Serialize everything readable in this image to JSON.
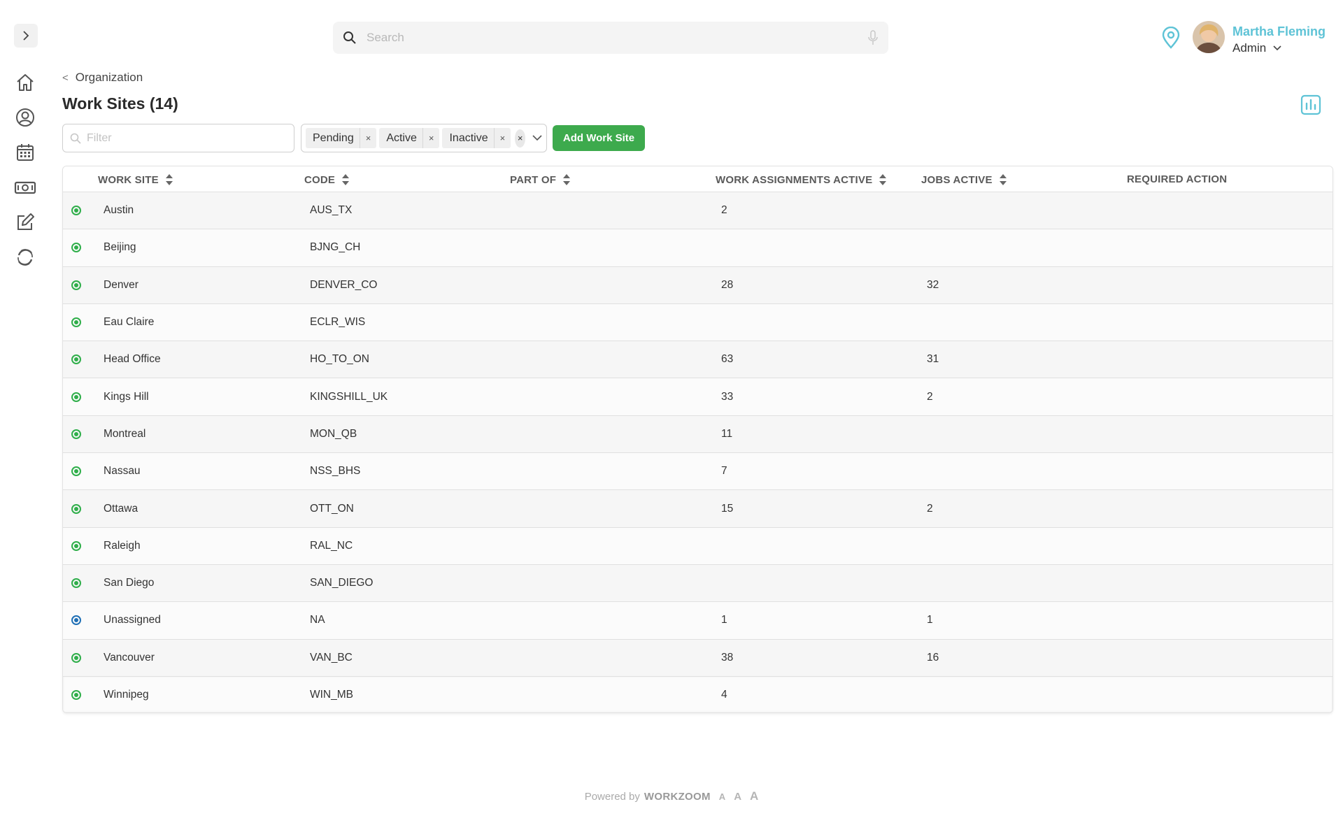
{
  "search": {
    "placeholder": "Search"
  },
  "user": {
    "name": "Martha Fleming",
    "role": "Admin"
  },
  "breadcrumb": {
    "label": "Organization"
  },
  "page": {
    "title": "Work Sites (14)"
  },
  "filter": {
    "placeholder": "Filter"
  },
  "status_chips": [
    {
      "label": "Pending"
    },
    {
      "label": "Active"
    },
    {
      "label": "Inactive"
    }
  ],
  "add_button": {
    "label": "Add Work Site"
  },
  "columns": {
    "work_site": "WORK SITE",
    "code": "CODE",
    "part_of": "PART OF",
    "work_assignments_active": "WORK ASSIGNMENTS ACTIVE",
    "jobs_active": "JOBS ACTIVE",
    "required_action": "REQUIRED ACTION"
  },
  "rows": [
    {
      "status": "active",
      "name": "Austin",
      "code": "AUS_TX",
      "part_of": "",
      "wa": "2",
      "jobs": "",
      "action": ""
    },
    {
      "status": "active",
      "name": "Beijing",
      "code": "BJNG_CH",
      "part_of": "",
      "wa": "",
      "jobs": "",
      "action": ""
    },
    {
      "status": "active",
      "name": "Denver",
      "code": "DENVER_CO",
      "part_of": "",
      "wa": "28",
      "jobs": "32",
      "action": ""
    },
    {
      "status": "active",
      "name": "Eau Claire",
      "code": "ECLR_WIS",
      "part_of": "",
      "wa": "",
      "jobs": "",
      "action": ""
    },
    {
      "status": "active",
      "name": "Head Office",
      "code": "HO_TO_ON",
      "part_of": "",
      "wa": "63",
      "jobs": "31",
      "action": ""
    },
    {
      "status": "active",
      "name": "Kings Hill",
      "code": "KINGSHILL_UK",
      "part_of": "",
      "wa": "33",
      "jobs": "2",
      "action": ""
    },
    {
      "status": "active",
      "name": "Montreal",
      "code": "MON_QB",
      "part_of": "",
      "wa": "11",
      "jobs": "",
      "action": ""
    },
    {
      "status": "active",
      "name": "Nassau",
      "code": "NSS_BHS",
      "part_of": "",
      "wa": "7",
      "jobs": "",
      "action": ""
    },
    {
      "status": "active",
      "name": "Ottawa",
      "code": "OTT_ON",
      "part_of": "",
      "wa": "15",
      "jobs": "2",
      "action": ""
    },
    {
      "status": "active",
      "name": "Raleigh",
      "code": "RAL_NC",
      "part_of": "",
      "wa": "",
      "jobs": "",
      "action": ""
    },
    {
      "status": "active",
      "name": "San Diego",
      "code": "SAN_DIEGO",
      "part_of": "",
      "wa": "",
      "jobs": "",
      "action": ""
    },
    {
      "status": "unassigned",
      "name": "Unassigned",
      "code": "NA",
      "part_of": "",
      "wa": "1",
      "jobs": "1",
      "action": ""
    },
    {
      "status": "active",
      "name": "Vancouver",
      "code": "VAN_BC",
      "part_of": "",
      "wa": "38",
      "jobs": "16",
      "action": ""
    },
    {
      "status": "active",
      "name": "Winnipeg",
      "code": "WIN_MB",
      "part_of": "",
      "wa": "4",
      "jobs": "",
      "action": ""
    }
  ],
  "status_colors": {
    "active": "#2fae4a",
    "unassigned": "#1f6fb5"
  },
  "colors": {
    "accent": "#5ec3d6",
    "primary_button": "#3daa4d"
  },
  "footer": {
    "powered_by": "Powered by",
    "brand": "WORKZOOM",
    "font_sizes": [
      "A",
      "A",
      "A"
    ]
  }
}
